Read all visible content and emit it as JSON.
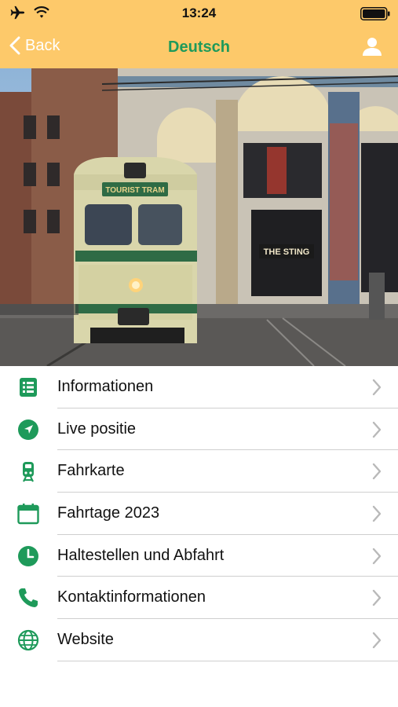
{
  "status": {
    "time": "13:24"
  },
  "nav": {
    "back_label": "Back",
    "title": "Deutsch"
  },
  "hero": {
    "sign_text": "TOURIST TRAM",
    "store_text": "THE STING"
  },
  "menu": [
    {
      "label": "Informationen",
      "icon": "document-list-icon"
    },
    {
      "label": "Live positie",
      "icon": "location-arrow-icon"
    },
    {
      "label": "Fahrkarte",
      "icon": "tram-icon"
    },
    {
      "label": "Fahrtage 2023",
      "icon": "calendar-icon"
    },
    {
      "label": "Haltestellen und Abfahrt",
      "icon": "clock-icon"
    },
    {
      "label": "Kontaktinformationen",
      "icon": "phone-icon"
    },
    {
      "label": "Website",
      "icon": "globe-icon"
    }
  ],
  "colors": {
    "header": "#fdc96a",
    "accent": "#1e9a5a"
  }
}
